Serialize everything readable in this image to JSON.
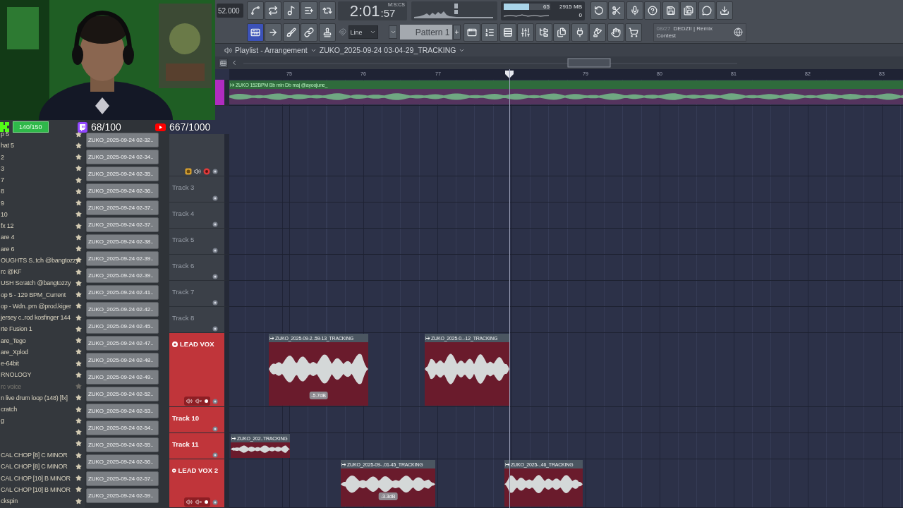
{
  "stream_stats": [
    {
      "kind": "kick",
      "count": "140/150"
    },
    {
      "kind": "twitch",
      "count": "68/100"
    },
    {
      "kind": "youtube",
      "count": "667/1000"
    }
  ],
  "toolbar": {
    "tempo": "52.000",
    "time": {
      "main": "2:01",
      "fraction": ":57",
      "unit": "M:S:CS"
    },
    "cpu_meter": {
      "level": 0.55,
      "reading": "65"
    },
    "memory": "2915 MB",
    "polyphony": "0",
    "tools": [
      {
        "selected": true
      },
      {
        "selected": false
      },
      {
        "selected": false
      },
      {
        "selected": false
      },
      {
        "selected": false
      }
    ],
    "snap": "Line",
    "pattern": "Pattern 1",
    "add_pattern": "+",
    "news": {
      "date": "08/27",
      "title": "DEDZII | Remix Contest"
    }
  },
  "browser": {
    "items": [
      {
        "name": "p 5",
        "disabled": false
      },
      {
        "name": "hat 5",
        "disabled": false
      },
      {
        "name": "2",
        "disabled": false
      },
      {
        "name": "3",
        "disabled": false
      },
      {
        "name": "7",
        "disabled": false
      },
      {
        "name": "8",
        "disabled": false
      },
      {
        "name": "9",
        "disabled": false
      },
      {
        "name": "10",
        "disabled": false
      },
      {
        "name": "fx 12",
        "disabled": false
      },
      {
        "name": "are 4",
        "disabled": false
      },
      {
        "name": "are 6",
        "disabled": false
      },
      {
        "name": "OUGHTS S..tch @bangtozzy",
        "disabled": false
      },
      {
        "name": "rc @KF",
        "disabled": false
      },
      {
        "name": "USH Scratch @bangtozzy",
        "disabled": false
      },
      {
        "name": "op 5 - 129 BPM_Current",
        "disabled": false
      },
      {
        "name": "op - Wdn..pm @prod.kiger",
        "disabled": false
      },
      {
        "name": "jersey c..rod kosfinger 144",
        "disabled": false
      },
      {
        "name": "rte Fusion 1",
        "disabled": false
      },
      {
        "name": "are_Tego",
        "disabled": false
      },
      {
        "name": "are_Xplod",
        "disabled": false
      },
      {
        "name": "e-64bit",
        "disabled": false
      },
      {
        "name": "RNOLOGY",
        "disabled": false
      },
      {
        "name": "rc voice",
        "disabled": true
      },
      {
        "name": "n live drum loop (148) [fx]",
        "disabled": false
      },
      {
        "name": "cratch",
        "disabled": false
      },
      {
        "name": "g",
        "disabled": false
      },
      {
        "disabled": false
      },
      {
        "disabled": false
      },
      {
        "name": "CAL CHOP [8] C MINOR",
        "disabled": false
      },
      {
        "name": "CAL CHOP [8] C MINOR",
        "disabled": false
      },
      {
        "name": "CAL CHOP [10] B MINOR",
        "disabled": false
      },
      {
        "name": "CAL CHOP [10] B MINOR",
        "disabled": false
      },
      {
        "name": "ckspin",
        "disabled": false
      }
    ],
    "recordings": [
      "ZUKO_2025-09-24 02-32..",
      "ZUKO_2025-09-24 02-34..",
      "ZUKO_2025-09-24 02-35..",
      "ZUKO_2025-09-24 02-36..",
      "ZUKO_2025-09-24 02-37..",
      "ZUKO_2025-09-24 02-37..",
      "ZUKO_2025-09-24 02-38..",
      "ZUKO_2025-09-24 02-39..",
      "ZUKO_2025-09-24 02-39..",
      "ZUKO_2025-09-24 02-41..",
      "ZUKO_2025-09-24 02-42..",
      "ZUKO_2025-09-24 02-45..",
      "ZUKO_2025-09-24 02-47..",
      "ZUKO_2025-09-24 02-48..",
      "ZUKO_2025-09-24 02-49..",
      "ZUKO_2025-09-24 02-52..",
      "ZUKO_2025-09-24 02-53..",
      "ZUKO_2025-09-24 02-54..",
      "ZUKO_2025-09-24 02-55..",
      "ZUKO_2025-09-24 02-56..",
      "ZUKO_2025-09-24 02-57..",
      "ZUKO_2025-09-24 02-59.."
    ]
  },
  "playlist": {
    "title": "Playlist - Arrangement",
    "arrangement": "ZUKO_2025-09-24 03-04-29_TRACKING",
    "ruler": [
      "75",
      "76",
      "77",
      "79",
      "80",
      "81",
      "82",
      "83"
    ],
    "tracks": [
      {
        "kind": "loop",
        "color": "#b02cc0",
        "clips": [
          {
            "kind": "loop",
            "name": "ZUKO 152BPM Bb min Db maj @ayoojune_"
          }
        ]
      },
      {
        "kind": "tools",
        "color": "#3b4048"
      },
      {
        "kind": "plain",
        "name": "Track 3",
        "color": "#3b4048"
      },
      {
        "kind": "plain",
        "name": "Track 4",
        "color": "#3b4048"
      },
      {
        "kind": "plain",
        "name": "Track 5",
        "color": "#3b4048"
      },
      {
        "kind": "plain",
        "name": "Track 6",
        "color": "#3b4048"
      },
      {
        "kind": "plain",
        "name": "Track 7",
        "color": "#3b4048"
      },
      {
        "kind": "plain",
        "name": "Track 8",
        "color": "#3b4048"
      },
      {
        "kind": "group",
        "name": "LEAD VOX",
        "color": "#c0353a",
        "clips": [
          {
            "kind": "vocal",
            "name": "ZUKO_2025-09-2..59-13_TRACKING",
            "gain": "-5.7dB"
          },
          {
            "kind": "vocal",
            "name": "ZUKO_2025-0..-12_TRACKING"
          }
        ]
      },
      {
        "kind": "plain",
        "name": "Track 10",
        "color": "#c0353a"
      },
      {
        "kind": "plain",
        "name": "Track 11",
        "color": "#c0353a",
        "clips": [
          {
            "kind": "vocal",
            "name": "ZUKO_202..TRACKING"
          }
        ]
      },
      {
        "kind": "group",
        "name": "LEAD VOX 2",
        "color": "#c0353a",
        "clips": [
          {
            "kind": "vocal",
            "name": "ZUKO_2025-09-..01-45_TRACKING",
            "gain": "-3.3dB"
          },
          {
            "kind": "vocal",
            "name": "ZUKO_2025-..46_TRACKING"
          }
        ]
      }
    ]
  }
}
